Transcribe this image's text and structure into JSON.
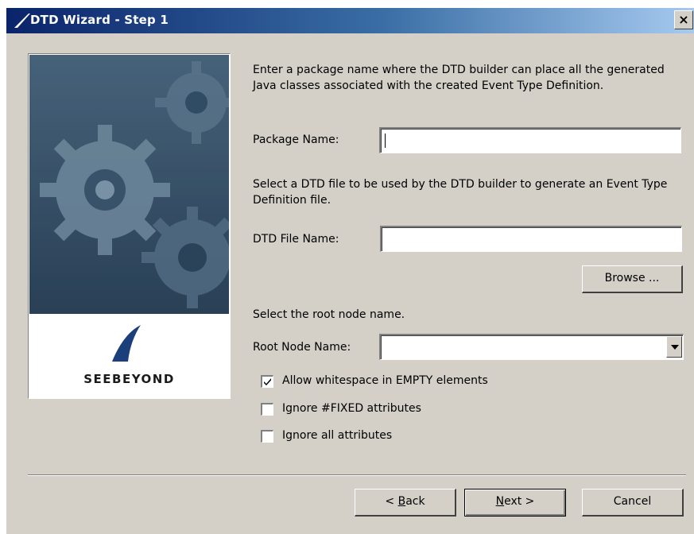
{
  "window": {
    "title": "DTD Wizard - Step 1",
    "close_glyph": "×"
  },
  "side_panel": {
    "logo_text": "SEEBEYOND"
  },
  "intro": {
    "package_text": "Enter a package name where the DTD builder can place all the generated Java classes associated with the created Event Type Definition.",
    "dtd_text": "Select a DTD file to be used by the DTD builder to generate an Event Type Definition file.",
    "root_text": "Select the root node name."
  },
  "form": {
    "package_label": "Package Name:",
    "package_value": "",
    "dtd_label": "DTD File Name:",
    "dtd_value": "",
    "browse_label": "Browse ...",
    "root_label": "Root Node Name:",
    "root_value": ""
  },
  "options": [
    {
      "label": "Allow whitespace in EMPTY elements",
      "checked": true
    },
    {
      "label": "Ignore #FIXED attributes",
      "checked": false
    },
    {
      "label": "Ignore all attributes",
      "checked": false
    }
  ],
  "buttons": {
    "back_mnemonic": "B",
    "back_rest": "ack",
    "back_prefix": "< ",
    "next_mnemonic": "N",
    "next_rest": "ext >",
    "cancel": "Cancel"
  }
}
